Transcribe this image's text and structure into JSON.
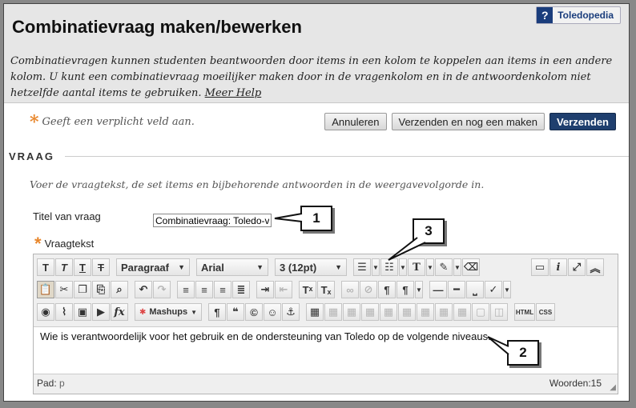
{
  "header": {
    "title": "Combinatievraag maken/bewerken",
    "help_badge_icon": "?",
    "help_badge_label": "Toledopedia",
    "intro_text": "Combinatievragen kunnen studenten beantwoorden door items in een kolom te koppelen aan items in een andere kolom. U kunt een combinatievraag moeilijker maken door in de vragenkolom en in de antwoordenkolom niet hetzelfde aantal items te gebruiken.",
    "help_link": "Meer Help"
  },
  "required_note": "Geeft een verplicht veld aan.",
  "buttons": {
    "cancel": "Annuleren",
    "submit_and_new": "Verzenden en nog een maken",
    "submit": "Verzenden"
  },
  "section": {
    "heading": "VRAAG",
    "description": "Voer de vraagtekst, de set items en bijbehorende antwoorden in de weergavevolgorde in."
  },
  "form": {
    "title_label": "Titel van vraag",
    "title_value": "Combinatievraag: Toledo-ve",
    "question_text_label": "Vraagtekst"
  },
  "editor": {
    "format_select": "Paragraaf",
    "font_select": "Arial",
    "size_select": "3 (12pt)",
    "mashups_label": "Mashups",
    "html_button": "HTML",
    "css_button": "CSS",
    "content": "Wie is verantwoordelijk voor het gebruik en de ondersteuning van Toledo op de volgende niveaus.",
    "path_label": "Pad:",
    "path_value": "p",
    "word_count": "Woorden:15"
  },
  "callouts": [
    "1",
    "2",
    "3"
  ],
  "colors": {
    "header_bg": "#e6e6e6",
    "primary_button": "#1f3f6e",
    "required_star": "#e8862b",
    "help_badge": "#1a3d7c"
  }
}
